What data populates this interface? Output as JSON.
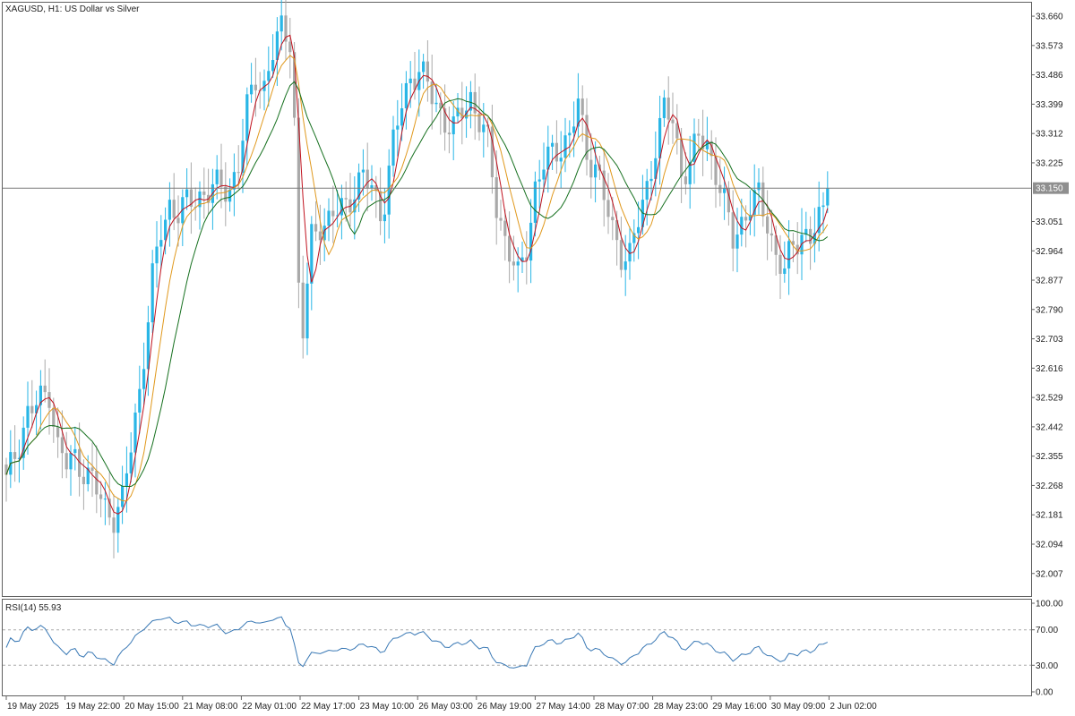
{
  "window": {
    "title": "XAGUSD, H1:  US Dollar vs Silver",
    "rsi_label": "RSI(14) 55.93"
  },
  "colors": {
    "bull": "#29b6e6",
    "bear": "#a9a9a9",
    "ma_fast": "#c0121e",
    "ma_mid": "#e0981c",
    "ma_slow": "#16701f",
    "rsi": "#3a79b5",
    "price_line": "#7a7a7a",
    "price_badge": "#8f8f8f",
    "rsi_levels": "#a8a8a8"
  },
  "chart_data": [
    {
      "type": "candlestick",
      "symbol": "XAGUSD",
      "timeframe": "H1",
      "title": "XAGUSD, H1:  US Dollar vs Silver",
      "ylim": [
        31.94,
        33.7
      ],
      "y_ticks": [
        "33.660",
        "33.573",
        "33.486",
        "33.399",
        "33.312",
        "33.225",
        "33.150",
        "33.051",
        "32.964",
        "32.877",
        "32.790",
        "32.703",
        "32.616",
        "32.529",
        "32.442",
        "32.355",
        "32.268",
        "32.181",
        "32.094",
        "32.007"
      ],
      "x_ticks": [
        "19 May 2025",
        "19 May 22:00",
        "20 May 15:00",
        "21 May 08:00",
        "22 May 01:00",
        "22 May 17:00",
        "23 May 10:00",
        "26 May 03:00",
        "26 May 19:00",
        "27 May 14:00",
        "28 May 07:00",
        "28 May 23:00",
        "29 May 16:00",
        "30 May 09:00",
        "2 Jun 02:00"
      ],
      "current_price": "33.150",
      "close_path": [
        [
          0,
          32.28
        ],
        [
          5,
          32.48
        ],
        [
          10,
          32.55
        ],
        [
          12,
          32.38
        ],
        [
          14,
          32.33
        ],
        [
          16,
          32.35
        ],
        [
          20,
          32.28
        ],
        [
          23,
          32.2
        ],
        [
          25,
          32.18
        ],
        [
          27,
          32.22
        ],
        [
          28,
          32.3
        ],
        [
          31,
          32.55
        ],
        [
          34,
          32.88
        ],
        [
          36,
          33.02
        ],
        [
          38,
          33.1
        ],
        [
          40,
          33.08
        ],
        [
          42,
          33.1
        ],
        [
          44,
          33.12
        ],
        [
          48,
          33.15
        ],
        [
          52,
          33.15
        ],
        [
          54,
          33.22
        ],
        [
          56,
          33.38
        ],
        [
          58,
          33.48
        ],
        [
          60,
          33.45
        ],
        [
          62,
          33.55
        ],
        [
          64,
          33.62
        ],
        [
          66,
          33.6
        ],
        [
          67,
          33.35
        ],
        [
          68,
          32.85
        ],
        [
          69,
          32.72
        ],
        [
          71,
          33.0
        ],
        [
          73,
          33.05
        ],
        [
          75,
          33.05
        ],
        [
          77,
          33.08
        ],
        [
          79,
          33.1
        ],
        [
          81,
          33.15
        ],
        [
          83,
          33.18
        ],
        [
          85,
          33.15
        ],
        [
          87,
          33.08
        ],
        [
          88,
          33.12
        ],
        [
          90,
          33.28
        ],
        [
          92,
          33.4
        ],
        [
          94,
          33.48
        ],
        [
          96,
          33.5
        ],
        [
          98,
          33.45
        ],
        [
          100,
          33.4
        ],
        [
          102,
          33.35
        ],
        [
          104,
          33.32
        ],
        [
          106,
          33.38
        ],
        [
          108,
          33.42
        ],
        [
          110,
          33.35
        ],
        [
          112,
          33.28
        ],
        [
          114,
          33.1
        ],
        [
          116,
          33.0
        ],
        [
          118,
          32.92
        ],
        [
          119,
          32.88
        ],
        [
          121,
          32.98
        ],
        [
          123,
          33.15
        ],
        [
          125,
          33.22
        ],
        [
          127,
          33.25
        ],
        [
          129,
          33.28
        ],
        [
          131,
          33.3
        ],
        [
          133,
          33.4
        ],
        [
          135,
          33.25
        ],
        [
          137,
          33.22
        ],
        [
          139,
          33.12
        ],
        [
          141,
          33.02
        ],
        [
          143,
          32.96
        ],
        [
          145,
          32.95
        ],
        [
          147,
          33.05
        ],
        [
          149,
          33.15
        ],
        [
          151,
          33.28
        ],
        [
          153,
          33.38
        ],
        [
          155,
          33.35
        ],
        [
          157,
          33.2
        ],
        [
          159,
          33.22
        ],
        [
          161,
          33.3
        ],
        [
          163,
          33.28
        ],
        [
          165,
          33.2
        ],
        [
          167,
          33.1
        ],
        [
          169,
          33.0
        ],
        [
          171,
          33.05
        ],
        [
          173,
          33.1
        ],
        [
          175,
          33.12
        ],
        [
          177,
          33.05
        ],
        [
          179,
          32.95
        ],
        [
          181,
          32.9
        ],
        [
          183,
          32.98
        ],
        [
          185,
          33.02
        ],
        [
          187,
          33.0
        ],
        [
          189,
          33.05
        ],
        [
          191,
          33.1
        ]
      ],
      "series": [
        {
          "name": "",
          "values_ref": "ma_fast",
          "color": "#c0121e"
        },
        {
          "name": "",
          "values_ref": "ma_mid",
          "color": "#e0981c"
        },
        {
          "name": "",
          "values_ref": "ma_slow",
          "color": "#16701f"
        }
      ]
    },
    {
      "type": "line",
      "title": "RSI(14) 55.93",
      "ylim": [
        0,
        100
      ],
      "y_ticks": [
        "100.00",
        "70.00",
        "30.00",
        "0.00"
      ],
      "levels": [
        70,
        30
      ],
      "last_value": 55.93
    }
  ]
}
